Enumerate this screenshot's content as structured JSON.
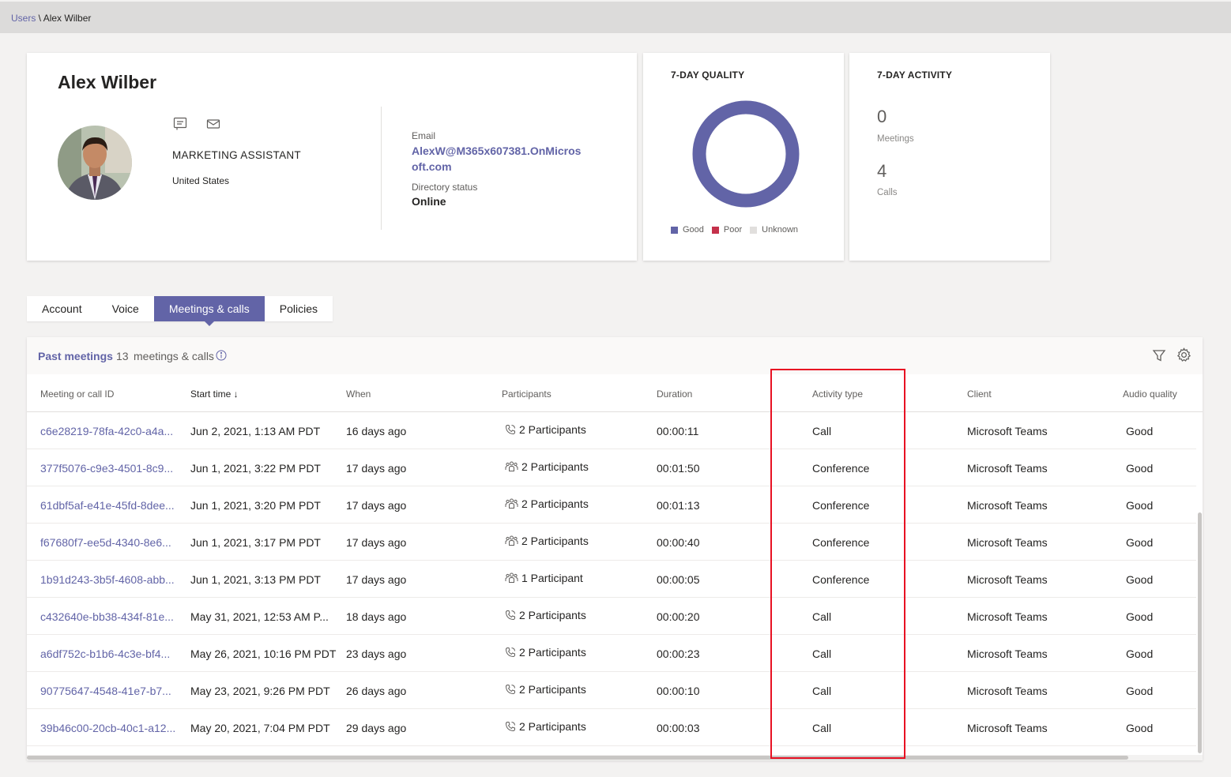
{
  "breadcrumb": {
    "root": "Users",
    "separator": " \\ ",
    "current": "Alex Wilber"
  },
  "profile": {
    "name": "Alex Wilber",
    "job_title": "MARKETING ASSISTANT",
    "country": "United States",
    "email_label": "Email",
    "email": "AlexW@M365x607381.OnMicrosoft.com",
    "directory_status_label": "Directory status",
    "directory_status": "Online"
  },
  "quality": {
    "title": "7-DAY QUALITY",
    "legend": [
      {
        "label": "Good",
        "color": "#6264a7"
      },
      {
        "label": "Poor",
        "color": "#c4314b"
      },
      {
        "label": "Unknown",
        "color": "#e1dfdd"
      }
    ],
    "good_fraction": 1.0
  },
  "activity": {
    "title": "7-DAY ACTIVITY",
    "meetings_value": "0",
    "meetings_label": "Meetings",
    "calls_value": "4",
    "calls_label": "Calls"
  },
  "tabs": [
    {
      "label": "Account"
    },
    {
      "label": "Voice"
    },
    {
      "label": "Meetings & calls",
      "active": true
    },
    {
      "label": "Policies"
    }
  ],
  "table": {
    "title": "Past meetings",
    "count": "13",
    "count_label": "meetings & calls",
    "columns": [
      "Meeting or call ID",
      "Start time ↓",
      "When",
      "Participants",
      "Duration",
      "Activity type",
      "Client",
      "Audio quality"
    ],
    "rows": [
      {
        "id": "c6e28219-78fa-42c0-a4a...",
        "start": "Jun 2, 2021, 1:13 AM PDT",
        "when": "16 days ago",
        "participant_icon": "phone-icon",
        "participants": "2 Participants",
        "duration": "00:00:11",
        "activity": "Call",
        "client": "Microsoft Teams",
        "audio": "Good"
      },
      {
        "id": "377f5076-c9e3-4501-8c9...",
        "start": "Jun 1, 2021, 3:22 PM PDT",
        "when": "17 days ago",
        "participant_icon": "people-icon",
        "participants": "2 Participants",
        "duration": "00:01:50",
        "activity": "Conference",
        "client": "Microsoft Teams",
        "audio": "Good"
      },
      {
        "id": "61dbf5af-e41e-45fd-8dee...",
        "start": "Jun 1, 2021, 3:20 PM PDT",
        "when": "17 days ago",
        "participant_icon": "people-icon",
        "participants": "2 Participants",
        "duration": "00:01:13",
        "activity": "Conference",
        "client": "Microsoft Teams",
        "audio": "Good"
      },
      {
        "id": "f67680f7-ee5d-4340-8e6...",
        "start": "Jun 1, 2021, 3:17 PM PDT",
        "when": "17 days ago",
        "participant_icon": "people-icon",
        "participants": "2 Participants",
        "duration": "00:00:40",
        "activity": "Conference",
        "client": "Microsoft Teams",
        "audio": "Good"
      },
      {
        "id": "1b91d243-3b5f-4608-abb...",
        "start": "Jun 1, 2021, 3:13 PM PDT",
        "when": "17 days ago",
        "participant_icon": "people-icon",
        "participants": "1 Participant",
        "duration": "00:00:05",
        "activity": "Conference",
        "client": "Microsoft Teams",
        "audio": "Good"
      },
      {
        "id": "c432640e-bb38-434f-81e...",
        "start": "May 31, 2021, 12:53 AM P...",
        "when": "18 days ago",
        "participant_icon": "phone-icon",
        "participants": "2 Participants",
        "duration": "00:00:20",
        "activity": "Call",
        "client": "Microsoft Teams",
        "audio": "Good"
      },
      {
        "id": "a6df752c-b1b6-4c3e-bf4...",
        "start": "May 26, 2021, 10:16 PM PDT",
        "when": "23 days ago",
        "participant_icon": "phone-icon",
        "participants": "2 Participants",
        "duration": "00:00:23",
        "activity": "Call",
        "client": "Microsoft Teams",
        "audio": "Good"
      },
      {
        "id": "90775647-4548-41e7-b7...",
        "start": "May 23, 2021, 9:26 PM PDT",
        "when": "26 days ago",
        "participant_icon": "phone-icon",
        "participants": "2 Participants",
        "duration": "00:00:10",
        "activity": "Call",
        "client": "Microsoft Teams",
        "audio": "Good"
      },
      {
        "id": "39b46c00-20cb-40c1-a12...",
        "start": "May 20, 2021, 7:04 PM PDT",
        "when": "29 days ago",
        "participant_icon": "phone-icon",
        "participants": "2 Participants",
        "duration": "00:00:03",
        "activity": "Call",
        "client": "Microsoft Teams",
        "audio": "Good"
      }
    ]
  },
  "colors": {
    "accent": "#6264a7",
    "highlight": "#e81123"
  }
}
